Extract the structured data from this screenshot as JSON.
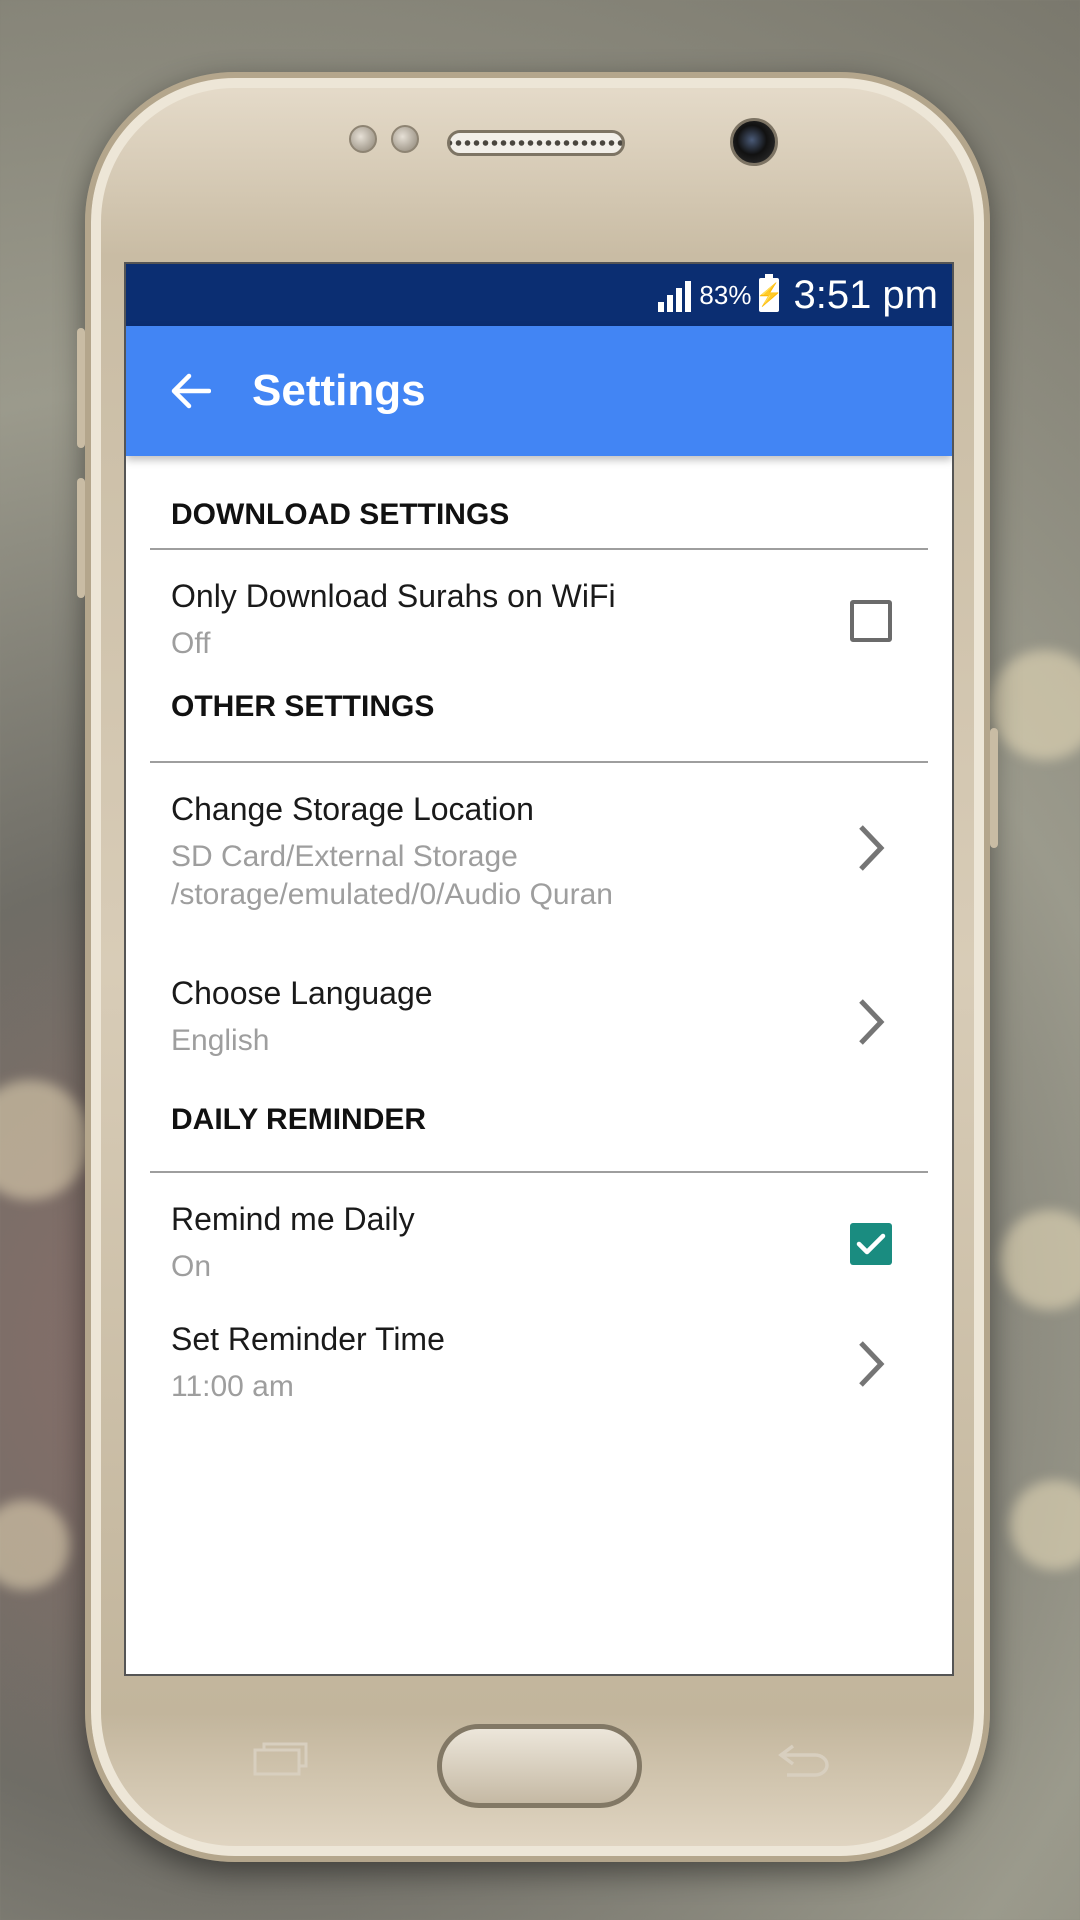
{
  "status_bar": {
    "battery_percent": "83%",
    "time": "3:51 pm",
    "icons": [
      "signal-icon",
      "battery-charging-icon"
    ]
  },
  "app_bar": {
    "title": "Settings",
    "back_icon": "arrow-left-icon"
  },
  "sections": {
    "download": {
      "header": "DOWNLOAD SETTINGS",
      "wifi_only": {
        "title": "Only Download Surahs on WiFi",
        "summary": "Off",
        "checked": false
      }
    },
    "other": {
      "header": "OTHER SETTINGS",
      "storage": {
        "title": "Change Storage Location",
        "summary_line1": "SD Card/External Storage",
        "summary_line2": "/storage/emulated/0/Audio Quran"
      },
      "language": {
        "title": "Choose Language",
        "summary": "English"
      }
    },
    "reminder": {
      "header": "DAILY REMINDER",
      "remind_daily": {
        "title": "Remind me Daily",
        "summary": "On",
        "checked": true
      },
      "reminder_time": {
        "title": "Set Reminder Time",
        "summary": "11:00 am"
      }
    }
  },
  "colors": {
    "status_bar": "#0b2e72",
    "app_bar": "#4285f4",
    "checkbox_checked": "#1a8c80",
    "summary_text": "#9e9e9e"
  }
}
